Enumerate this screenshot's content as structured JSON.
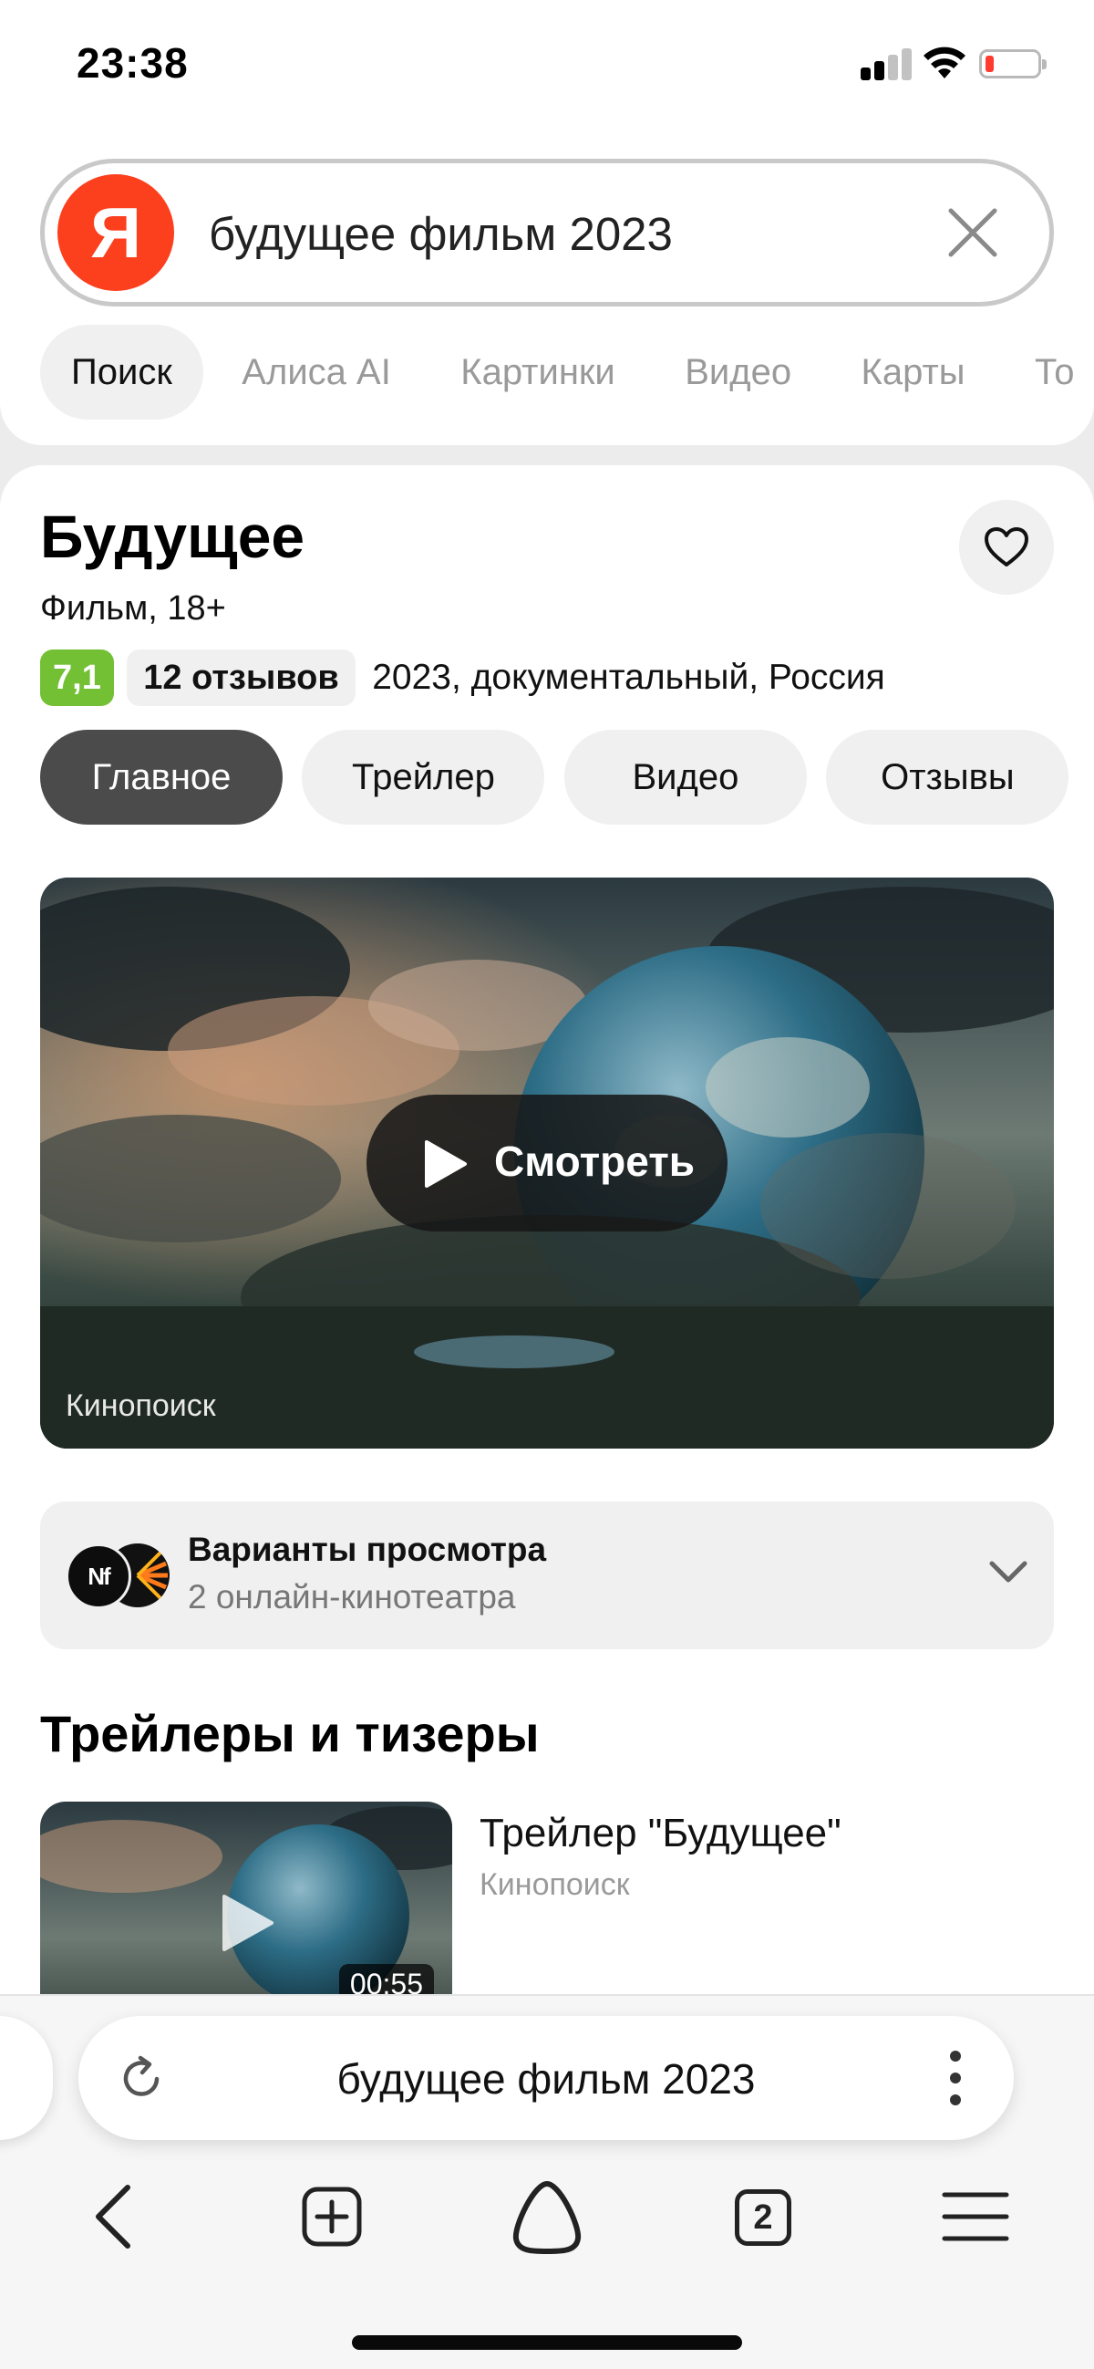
{
  "status_bar": {
    "time": "23:38",
    "icons": [
      "signal-icon",
      "wifi-icon",
      "battery-icon"
    ],
    "battery_color": "#ff3b30"
  },
  "search": {
    "logo_letter": "Я",
    "logo_color": "#fc3f1d",
    "query": "будущее фильм 2023",
    "clear_icon": "close-icon"
  },
  "search_tabs": [
    {
      "label": "Поиск",
      "active": true
    },
    {
      "label": "Алиса AI",
      "active": false
    },
    {
      "label": "Картинки",
      "active": false
    },
    {
      "label": "Видео",
      "active": false
    },
    {
      "label": "Карты",
      "active": false
    },
    {
      "label": "То",
      "active": false
    }
  ],
  "movie": {
    "title": "Будущее",
    "subtitle": "Фильм, 18+",
    "rating": "7,1",
    "rating_color": "#73c035",
    "reviews": "12 отзывов",
    "meta": "2023, документальный, Россия",
    "favorite_icon": "heart-icon"
  },
  "pills": [
    {
      "label": "Главное",
      "active": true
    },
    {
      "label": "Трейлер",
      "active": false
    },
    {
      "label": "Видео",
      "active": false
    },
    {
      "label": "Отзывы",
      "active": false
    }
  ],
  "hero": {
    "watch_label": "Смотреть",
    "source": "Кинопоиск",
    "play_icon": "play-icon"
  },
  "options": {
    "title": "Варианты просмотра",
    "subtitle": "2 онлайн-кинотеатра",
    "logo_text": "Nf",
    "chevron_icon": "chevron-down-icon"
  },
  "trailers": {
    "section_title": "Трейлеры и тизеры",
    "items": [
      {
        "title": "Трейлер \"Будущее\"",
        "source": "Кинопоиск",
        "duration": "00:55"
      }
    ]
  },
  "browser": {
    "address": "будущее фильм 2023",
    "tabs_count": "2",
    "icons": [
      "back-icon",
      "new-tab-icon",
      "alice-icon",
      "tabs-icon",
      "menu-icon",
      "reload-icon",
      "more-icon"
    ]
  }
}
